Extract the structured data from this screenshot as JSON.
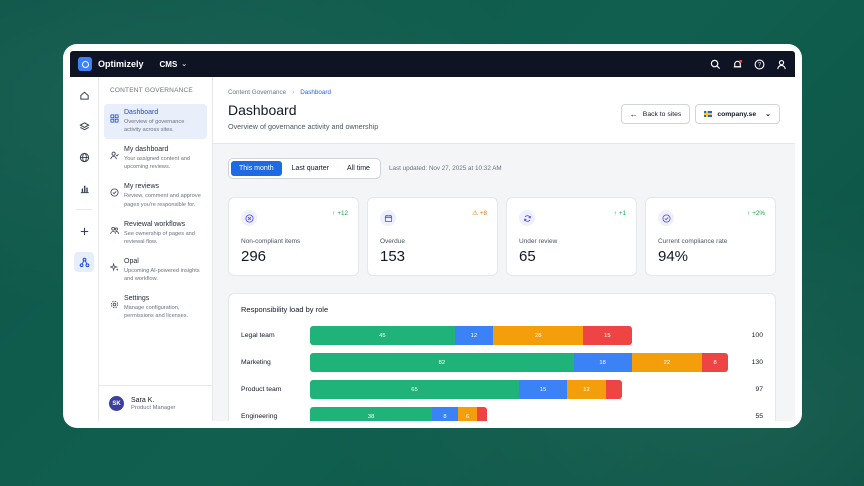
{
  "topbar": {
    "brand": "Optimizely",
    "product": "CMS"
  },
  "sidebar": {
    "section_title": "Content Governance",
    "items": [
      {
        "label": "Dashboard",
        "desc": "Overview of governance activity across sites."
      },
      {
        "label": "My dashboard",
        "desc": "Your assigned content and upcoming reviews."
      },
      {
        "label": "My reviews",
        "desc": "Review, comment and approve pages you're responsible for."
      },
      {
        "label": "Reviewal workflows",
        "desc": "See ownership of pages and reviewal flow."
      },
      {
        "label": "Opal",
        "desc": "Upcoming AI-powered insights and workflow."
      },
      {
        "label": "Settings",
        "desc": "Manage configuration, permissions and licenses."
      }
    ],
    "user": {
      "initials": "SK",
      "name": "Sara K.",
      "role": "Product Manager"
    }
  },
  "header": {
    "breadcrumb": [
      "Content Governance",
      "Dashboard"
    ],
    "title": "Dashboard",
    "subtitle": "Overview of governance activity and ownership",
    "back_label": "Back to sites",
    "site_label": "company.se"
  },
  "filters": {
    "options": [
      "This month",
      "Last quarter",
      "All time"
    ],
    "last_updated": "Last updated: Nov 27, 2025 at 10:32 AM"
  },
  "cards": [
    {
      "label": "Non-compliant items",
      "value": "296",
      "delta": "+12",
      "delta_kind": "up"
    },
    {
      "label": "Overdue",
      "value": "153",
      "delta": "+8",
      "delta_kind": "warn"
    },
    {
      "label": "Under review",
      "value": "65",
      "delta": "+1",
      "delta_kind": "up"
    },
    {
      "label": "Current compliance rate",
      "value": "94%",
      "delta": "+2%",
      "delta_kind": "up"
    }
  ],
  "responsibility": {
    "title": "Responsibility load by role",
    "colors": [
      "#1fb37a",
      "#3b82f6",
      "#f59e0b",
      "#ef4444"
    ],
    "rows": [
      {
        "role": "Legal team",
        "segments": [
          45,
          12,
          28,
          15
        ],
        "total": "100"
      },
      {
        "role": "Marketing",
        "segments": [
          82,
          18,
          22,
          8
        ],
        "total": "130"
      },
      {
        "role": "Product team",
        "segments": [
          65,
          15,
          12,
          5
        ],
        "total": "97"
      },
      {
        "role": "Engineering",
        "segments": [
          38,
          8,
          6,
          3
        ],
        "total": "55"
      }
    ]
  }
}
